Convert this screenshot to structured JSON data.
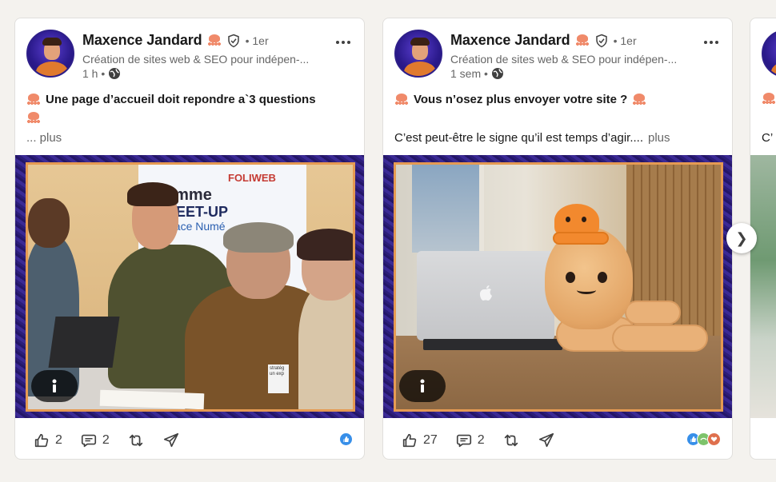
{
  "posts": [
    {
      "author": "Maxence Jandard",
      "degree": "• 1er",
      "headline": "Création de sites web & SEO pour indépen-...",
      "time": "1 h •",
      "text_line1": "Une page d’accueil doit repondre a`3 questions",
      "text_line2": "... plus",
      "image_texts": [
        "gramme",
        "MEET-UP",
        "space Numé",
        "FOLIWEB",
        "stratég",
        "un exp"
      ],
      "likes": "2",
      "comments": "2"
    },
    {
      "author": "Maxence Jandard",
      "degree": "• 1er",
      "headline": "Création de sites web & SEO pour indépen-...",
      "time": "1 sem •",
      "text_line1": "Vous n’osez plus envoyer votre site ?",
      "text_line2": "C’est peut-être le signe qu’il est temps d’agir....",
      "see_more": "plus",
      "likes": "27",
      "comments": "2"
    },
    {
      "text_partial": "C’"
    }
  ],
  "icons": {
    "verified": "shield-check-icon",
    "visibility": "globe-icon",
    "like": "thumbs-up-icon",
    "comment": "comment-icon",
    "repost": "repost-icon",
    "send": "send-icon",
    "info": "info-icon",
    "next": "chevron-right-icon"
  },
  "carousel": {
    "next_glyph": "❯"
  },
  "colors": {
    "frame": "#e59a52",
    "media_bg": "#2c1d7a",
    "like": "#378fe9"
  }
}
